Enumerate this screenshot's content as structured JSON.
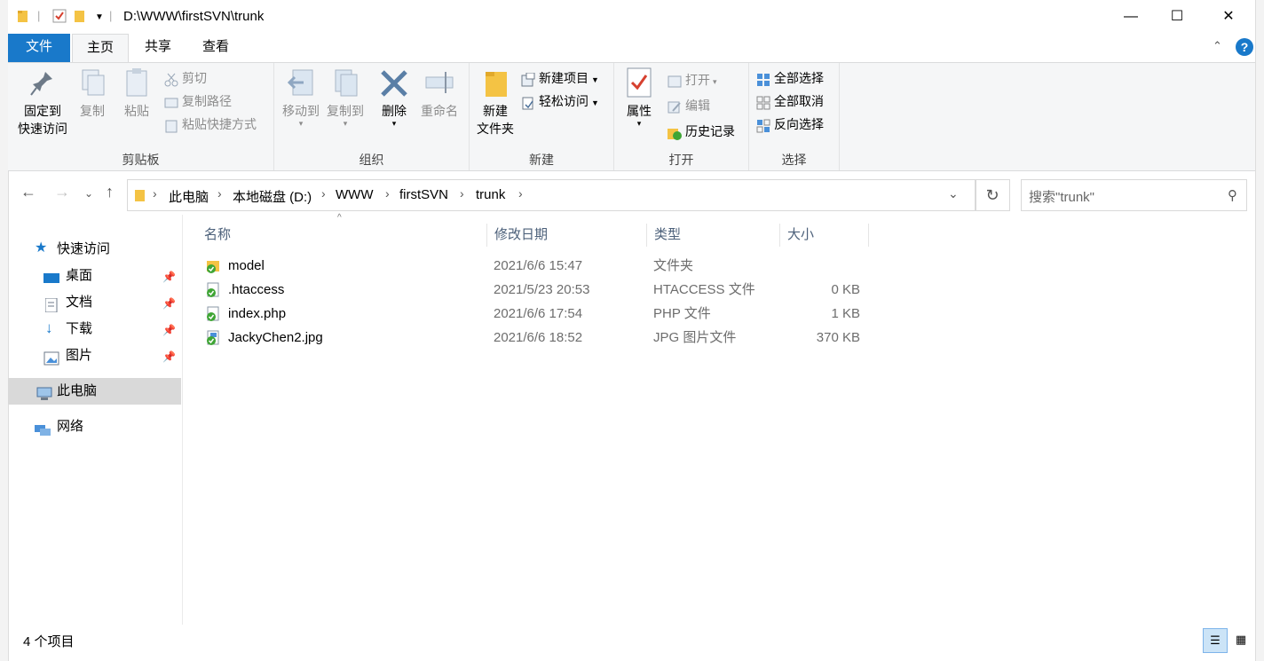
{
  "window": {
    "title": "D:\\WWW\\firstSVN\\trunk",
    "minimize_glyph": "—",
    "maximize_glyph": "☐",
    "close_glyph": "✕"
  },
  "tabs": {
    "file": "文件",
    "home": "主页",
    "share": "共享",
    "view": "查看"
  },
  "ribbon": {
    "clipboard": {
      "label": "剪贴板",
      "pin": "固定到\n快速访问",
      "pin_l1": "固定到",
      "pin_l2": "快速访问",
      "copy": "复制",
      "paste": "粘贴",
      "cut": "剪切",
      "copy_path": "复制路径",
      "paste_shortcut": "粘贴快捷方式"
    },
    "organize": {
      "label": "组织",
      "move_to": "移动到",
      "copy_to": "复制到",
      "delete": "删除",
      "rename": "重命名"
    },
    "new": {
      "label": "新建",
      "new_folder_l1": "新建",
      "new_folder_l2": "文件夹",
      "new_item": "新建项目",
      "easy_access": "轻松访问"
    },
    "open": {
      "label": "打开",
      "properties": "属性",
      "open": "打开",
      "edit": "编辑",
      "history": "历史记录"
    },
    "select": {
      "label": "选择",
      "select_all": "全部选择",
      "select_none": "全部取消",
      "invert": "反向选择"
    }
  },
  "address": {
    "crumbs": [
      "此电脑",
      "本地磁盘 (D:)",
      "WWW",
      "firstSVN",
      "trunk"
    ],
    "search_placeholder": "搜索\"trunk\""
  },
  "nav": {
    "quick_access": "快速访问",
    "desktop": "桌面",
    "documents": "文档",
    "downloads": "下载",
    "pictures": "图片",
    "this_pc": "此电脑",
    "network": "网络"
  },
  "columns": {
    "name": "名称",
    "modified": "修改日期",
    "type": "类型",
    "size": "大小"
  },
  "files": [
    {
      "name": "model",
      "modified": "2021/6/6 15:47",
      "type": "文件夹",
      "size": "",
      "kind": "folder"
    },
    {
      "name": ".htaccess",
      "modified": "2021/5/23 20:53",
      "type": "HTACCESS 文件",
      "size": "0 KB",
      "kind": "file"
    },
    {
      "name": "index.php",
      "modified": "2021/6/6 17:54",
      "type": "PHP 文件",
      "size": "1 KB",
      "kind": "file"
    },
    {
      "name": "JackyChen2.jpg",
      "modified": "2021/6/6 18:52",
      "type": "JPG 图片文件",
      "size": "370 KB",
      "kind": "image"
    }
  ],
  "status": {
    "count": "4 个项目"
  },
  "colors": {
    "accent": "#1979ca",
    "svn_ok": "#3fa535",
    "folder": "#f4c344"
  }
}
